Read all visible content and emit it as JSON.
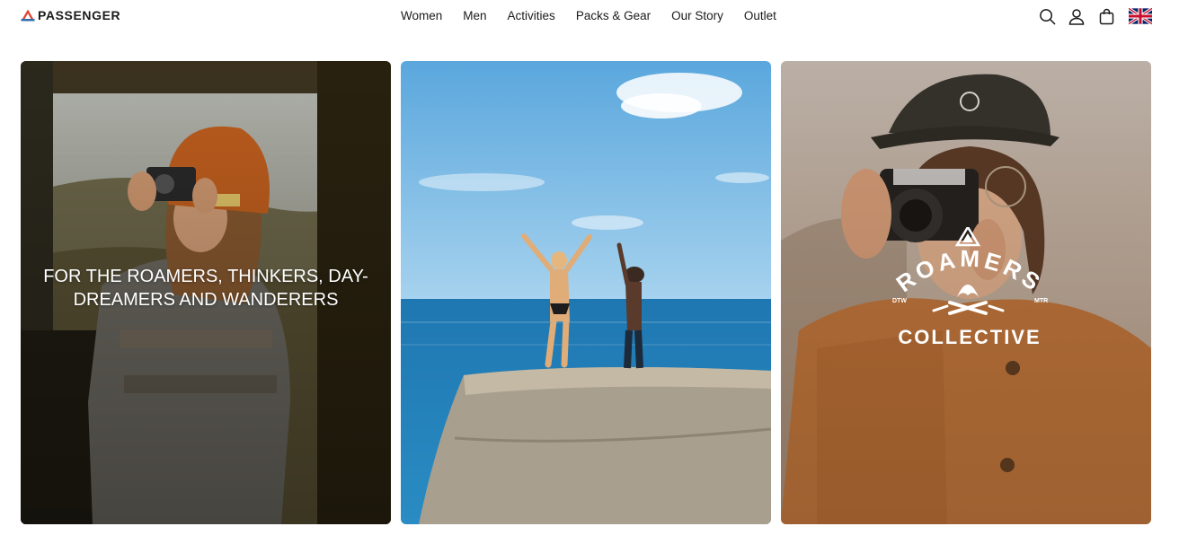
{
  "brand": {
    "name": "PASSENGER",
    "accent_red": "#e0432e",
    "accent_blue": "#2f6fb0"
  },
  "nav": {
    "items": [
      {
        "label": "Women"
      },
      {
        "label": "Men"
      },
      {
        "label": "Activities"
      },
      {
        "label": "Packs & Gear"
      },
      {
        "label": "Our Story"
      },
      {
        "label": "Outlet"
      }
    ]
  },
  "header_icons": {
    "search": "search-icon",
    "account": "user-icon",
    "cart": "bag-icon",
    "region": "uk-flag-icon"
  },
  "tiles": [
    {
      "caption": "FOR THE ROAMERS, THINKERS, DAY-DREAMERS AND WANDERERS",
      "image": "woman-in-orange-beanie-with-camera"
    },
    {
      "image": "two-people-jumping-off-pier-into-sea"
    },
    {
      "image": "person-in-cap-holding-camera",
      "badge": {
        "top": "ROAMERS",
        "bottom": "COLLECTIVE",
        "left_small": "DTW",
        "right_small": "MTR"
      }
    }
  ]
}
